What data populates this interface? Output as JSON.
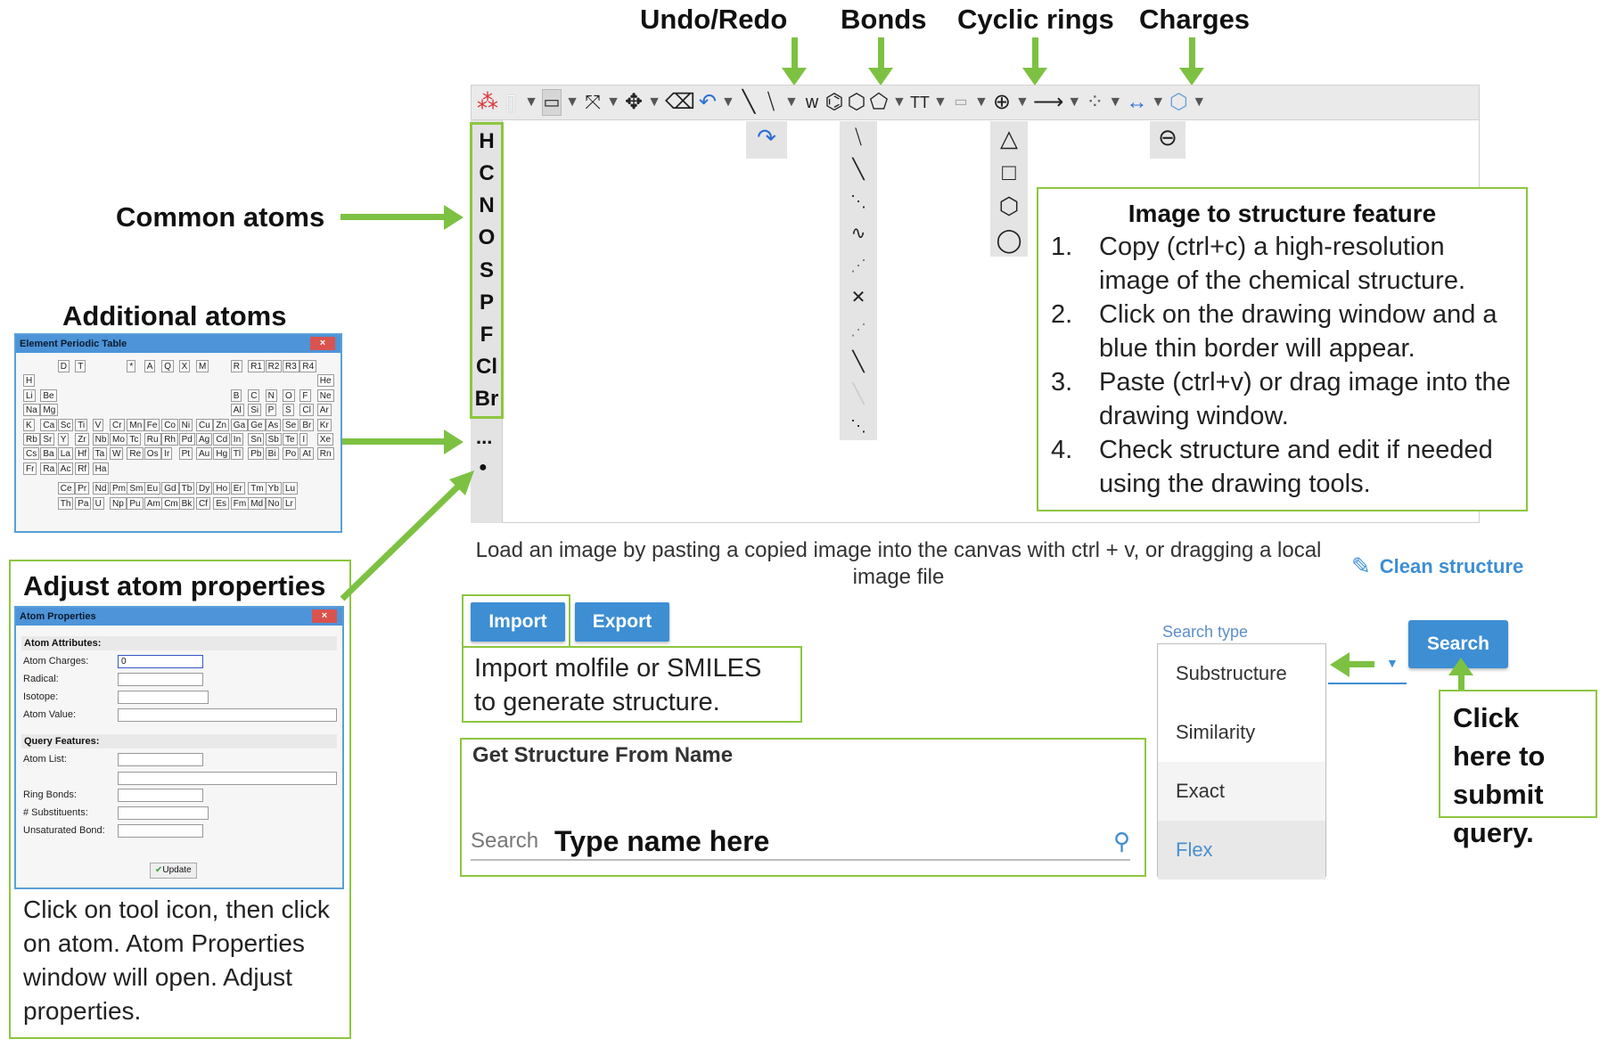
{
  "callouts": {
    "undo_redo": "Undo/Redo",
    "bonds": "Bonds",
    "cyclic_rings": "Cyclic rings",
    "charges": "Charges",
    "common_atoms": "Common atoms",
    "additional_atoms": "Additional atoms",
    "adjust_atom_properties": "Adjust atom properties",
    "adjust_description": "Click on tool icon, then click on atom. Atom Properties window will open. Adjust properties.",
    "import_description": "Import molfile or SMILES to generate structure.",
    "click_here": "Click here to submit query.",
    "type_name_here": "Type name here"
  },
  "image_to_structure": {
    "title": "Image to structure feature",
    "steps": [
      {
        "num": "1.",
        "text": "Copy (ctrl+c) a high-resolution image of the chemical structure."
      },
      {
        "num": "2.",
        "text": "Click on the drawing window and a blue thin border will appear."
      },
      {
        "num": "3.",
        "text": "Paste (ctrl+v) or drag image into the drawing window."
      },
      {
        "num": "4.",
        "text": "Check structure and edit if needed using the drawing tools."
      }
    ]
  },
  "editor": {
    "common_atoms": [
      "H",
      "C",
      "N",
      "O",
      "S",
      "P",
      "F",
      "Cl",
      "Br"
    ],
    "more_atoms": "...",
    "dot": "●",
    "canvas_hint": "Load an image by pasting a copied image into the canvas with ctrl + v, or dragging a local image file",
    "clean_structure": "Clean structure"
  },
  "buttons": {
    "import": "Import",
    "export": "Export",
    "search": "Search"
  },
  "name_search": {
    "title": "Get Structure From Name",
    "placeholder": "Search"
  },
  "search_type": {
    "label": "Search type",
    "options": [
      "Substructure",
      "Similarity",
      "Exact",
      "Flex"
    ]
  },
  "periodic_table": {
    "title": "Element Periodic Table",
    "close": "×"
  },
  "atom_properties": {
    "title": "Atom Properties",
    "close": "×",
    "attributes_section": "Atom Attributes:",
    "atom_charges": "Atom Charges:",
    "atom_charges_value": "0",
    "radical": "Radical:",
    "isotope": "Isotope:",
    "atom_value": "Atom Value:",
    "query_section": "Query Features:",
    "atom_list": "Atom List:",
    "ring_bonds": "Ring Bonds:",
    "substituents": "# Substituents:",
    "unsaturated_bond": "Unsaturated Bond:",
    "update": "Update"
  },
  "colors": {
    "accent_green": "#8cc63f",
    "button_blue": "#3d8ed3",
    "link_blue": "#3d8ed3"
  }
}
